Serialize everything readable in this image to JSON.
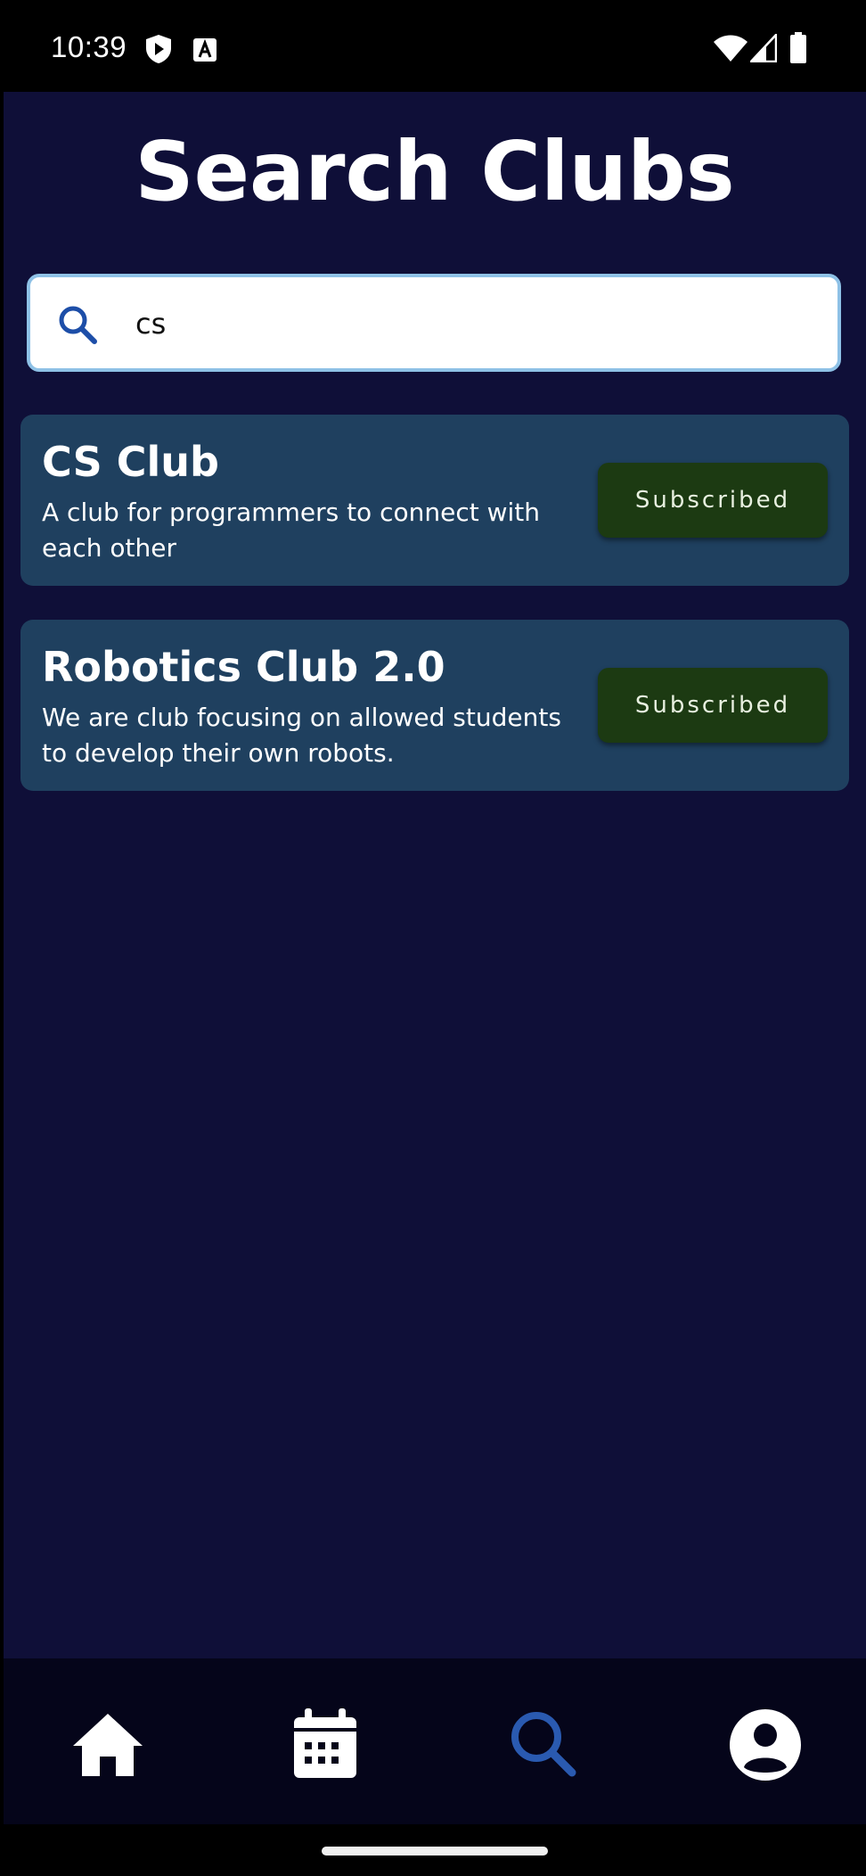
{
  "status_bar": {
    "time": "10:39"
  },
  "header": {
    "title": "Search Clubs"
  },
  "search": {
    "value": "cs"
  },
  "clubs": [
    {
      "name": "CS Club",
      "description": "A club for programmers to connect with each other",
      "button_label": "Subscribed"
    },
    {
      "name": "Robotics Club 2.0",
      "description": "We are club focusing on allowed students to develop their own robots.",
      "button_label": "Subscribed"
    }
  ],
  "bottom_nav": {
    "items": [
      {
        "icon": "home-icon",
        "active": false
      },
      {
        "icon": "calendar-icon",
        "active": false
      },
      {
        "icon": "search-icon",
        "active": true
      },
      {
        "icon": "profile-icon",
        "active": false
      }
    ]
  },
  "colors": {
    "background": "#0f0f38",
    "card": "#1f405f",
    "button": "#1c3a12",
    "active_nav": "#2a5ab0",
    "search_border": "#8ec1e6"
  }
}
